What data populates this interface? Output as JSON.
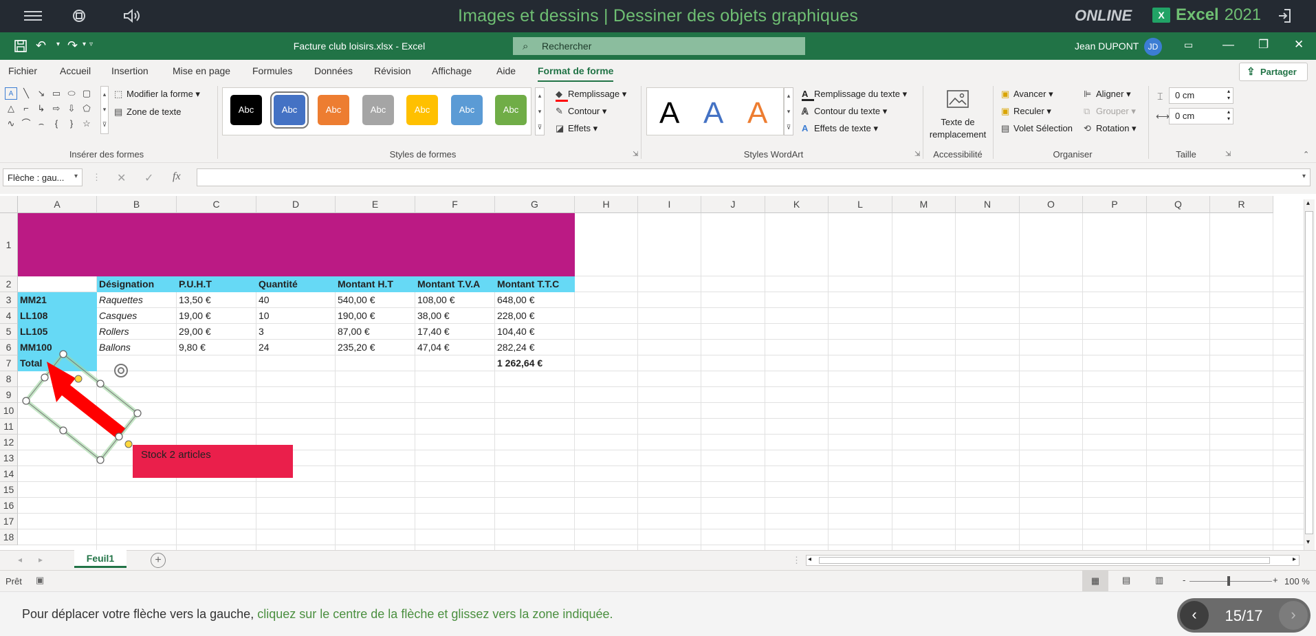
{
  "topbar": {
    "lesson_title": "Images et dessins | Dessiner des objets graphiques",
    "brand_online": "ONLINE",
    "brand_excel": "Excel",
    "brand_year": "2021",
    "brand_excel_icon": "X"
  },
  "titlebar": {
    "filename": "Facture club loisirs.xlsx - Excel",
    "search_placeholder": "Rechercher",
    "user_name": "Jean DUPONT",
    "user_initials": "JD"
  },
  "tabs": [
    "Fichier",
    "Accueil",
    "Insertion",
    "Mise en page",
    "Formules",
    "Données",
    "Révision",
    "Affichage",
    "Aide",
    "Format de forme"
  ],
  "active_tab": "Format de forme",
  "share_label": "Partager",
  "ribbon": {
    "insert_shapes": {
      "label": "Insérer des formes",
      "edit_shape": "Modifier la forme",
      "text_box": "Zone de texte"
    },
    "shape_styles": {
      "label": "Styles de formes",
      "swatch_text": "Abc",
      "swatch_colors": [
        "#000000",
        "#4472c4",
        "#ed7d31",
        "#a5a5a5",
        "#ffc000",
        "#5b9bd5",
        "#70ad47"
      ],
      "fill": "Remplissage",
      "outline": "Contour",
      "effects": "Effets"
    },
    "wordart": {
      "label": "Styles WordArt",
      "letter": "A",
      "letter_colors": [
        "#000000",
        "#4472c4",
        "#ed7d31"
      ],
      "text_fill": "Remplissage du texte",
      "text_outline": "Contour du texte",
      "text_effects": "Effets de texte"
    },
    "accessibility": {
      "label": "Accessibilité",
      "alt_text_line1": "Texte de",
      "alt_text_line2": "remplacement"
    },
    "arrange": {
      "label": "Organiser",
      "bring_forward": "Avancer",
      "send_backward": "Reculer",
      "selection_pane": "Volet Sélection",
      "align": "Aligner",
      "group": "Grouper",
      "rotate": "Rotation"
    },
    "size": {
      "label": "Taille",
      "height": "0 cm",
      "width": "0 cm"
    }
  },
  "formula_bar": {
    "name_box": "Flèche : gau...",
    "fx": "fx",
    "cancel": "✕",
    "confirm": "✓",
    "content": ""
  },
  "sheet": {
    "columns": [
      "A",
      "B",
      "C",
      "D",
      "E",
      "F",
      "G",
      "H",
      "I",
      "J",
      "K",
      "L",
      "M",
      "N",
      "O",
      "P",
      "Q",
      "R"
    ],
    "rows": [
      "1",
      "2",
      "3",
      "4",
      "5",
      "6",
      "7",
      "8",
      "9",
      "10",
      "11",
      "12",
      "13",
      "14",
      "15",
      "16",
      "17",
      "18"
    ],
    "header_row": [
      "",
      "Désignation",
      "P.U.H.T",
      "Quantité",
      "Montant H.T",
      "Montant T.V.A",
      "Montant T.T.C"
    ],
    "data_rows": [
      [
        "MM21",
        "Raquettes",
        "13,50 €",
        "40",
        "540,00 €",
        "108,00 €",
        "648,00 €"
      ],
      [
        "LL108",
        "Casques",
        "19,00 €",
        "10",
        "190,00 €",
        "38,00 €",
        "228,00 €"
      ],
      [
        "LL105",
        "Rollers",
        "29,00 €",
        "3",
        "87,00 €",
        "17,40 €",
        "104,40 €"
      ],
      [
        "MM100",
        "Ballons",
        "9,80 €",
        "24",
        "235,20 €",
        "47,04 €",
        "282,24 €"
      ]
    ],
    "total_label": "Total",
    "total_value": "1 262,64 €",
    "banner_color": "#bb1a84",
    "header_fill": "#66d9f5",
    "callout_text": "Stock 2 articles",
    "callout_color": "#ea1f4b",
    "arrow_color": "#ff0000"
  },
  "sheet_tab": "Feuil1",
  "status": {
    "ready": "Prêt",
    "zoom": "100 %"
  },
  "instruction": {
    "prefix": "Pour déplacer votre flèche vers la gauche, ",
    "highlight": "cliquez sur le centre de la flèche et glissez vers la zone indiquée."
  },
  "navigation": {
    "progress": "15/17"
  }
}
